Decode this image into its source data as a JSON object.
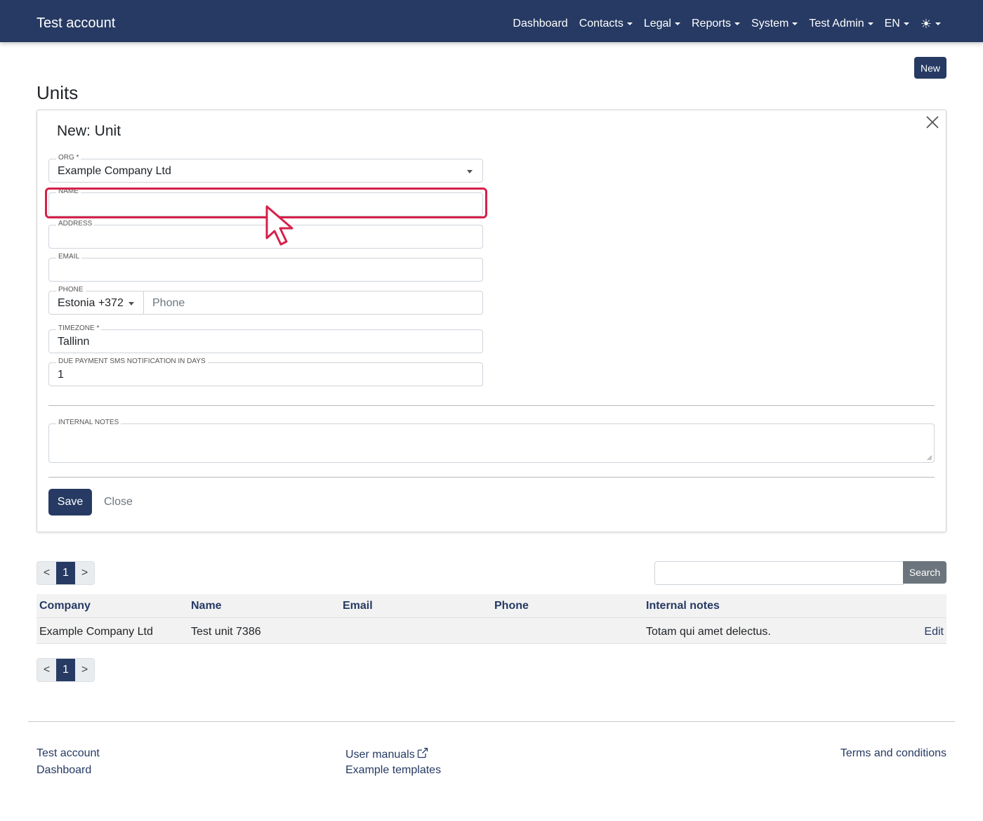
{
  "navbar": {
    "brand": "Test account",
    "items": [
      {
        "label": "Dashboard",
        "dropdown": false
      },
      {
        "label": "Contacts",
        "dropdown": true
      },
      {
        "label": "Legal",
        "dropdown": true
      },
      {
        "label": "Reports",
        "dropdown": true
      },
      {
        "label": "System",
        "dropdown": true
      },
      {
        "label": "Test Admin",
        "dropdown": true
      },
      {
        "label": "EN",
        "dropdown": true
      }
    ],
    "theme_icon": "☀"
  },
  "page": {
    "new_button": "New",
    "title": "Units"
  },
  "form": {
    "title": "New: Unit",
    "org": {
      "label": "ORG *",
      "value": "Example Company Ltd"
    },
    "name": {
      "label": "NAME",
      "value": ""
    },
    "address": {
      "label": "ADDRESS",
      "value": ""
    },
    "email": {
      "label": "EMAIL",
      "value": ""
    },
    "phone": {
      "label": "PHONE",
      "country": "Estonia +372",
      "placeholder": "Phone"
    },
    "timezone": {
      "label": "TIMEZONE *",
      "value": "Tallinn"
    },
    "due_sms": {
      "label": "DUE PAYMENT SMS NOTIFICATION IN DAYS",
      "value": "1"
    },
    "notes": {
      "label": "INTERNAL NOTES",
      "value": ""
    },
    "save_label": "Save",
    "close_label": "Close"
  },
  "pagination": {
    "prev": "<",
    "current": "1",
    "next": ">"
  },
  "search": {
    "button": "Search",
    "placeholder": ""
  },
  "table": {
    "headers": [
      "Company",
      "Name",
      "Email",
      "Phone",
      "Internal notes"
    ],
    "rows": [
      {
        "company": "Example Company Ltd",
        "name": "Test unit 7386",
        "email": "",
        "phone": "",
        "notes": "Totam qui amet delectus.",
        "action": "Edit"
      }
    ]
  },
  "footer": {
    "col1": [
      "Test account",
      "Dashboard"
    ],
    "col2": [
      "User manuals",
      "Example templates"
    ],
    "col3": [
      "Terms and conditions"
    ]
  },
  "colors": {
    "primary": "#263a63",
    "highlight": "#d6214a",
    "secondary": "#6c757d"
  }
}
